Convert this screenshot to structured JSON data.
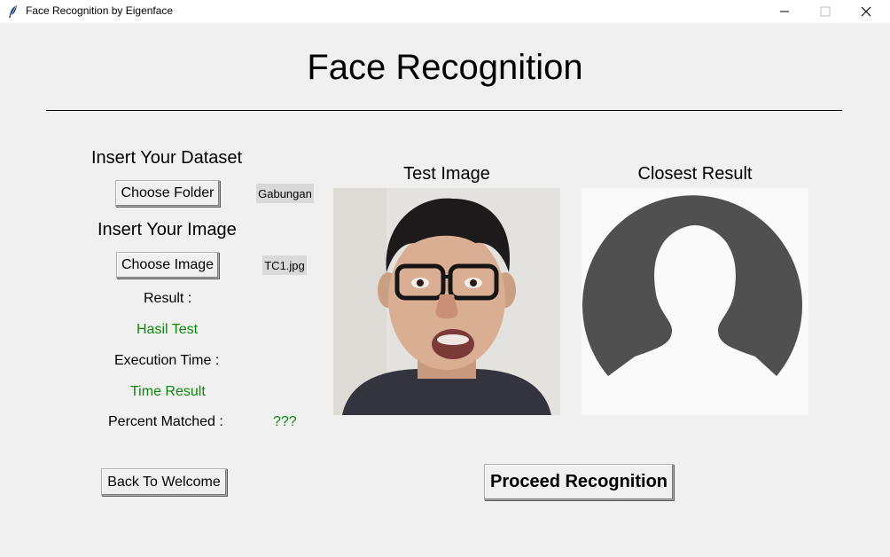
{
  "window": {
    "title": "Face Recognition by Eigenface"
  },
  "page": {
    "heading": "Face Recognition"
  },
  "dataset": {
    "label": "Insert Your Dataset",
    "button_label": "Choose Folder",
    "selected": "Gabungan"
  },
  "image": {
    "label": "Insert Your Image",
    "button_label": "Choose Image",
    "selected": "TC1.jpg"
  },
  "result": {
    "label": "Result :",
    "value": "Hasil Test"
  },
  "execution": {
    "label": "Execution Time :",
    "value": "Time Result"
  },
  "percent": {
    "label": "Percent Matched :",
    "value": "???"
  },
  "test_image": {
    "title": "Test Image"
  },
  "closest": {
    "title": "Closest Result"
  },
  "actions": {
    "back_label": "Back To Welcome",
    "proceed_label": "Proceed Recognition"
  },
  "colors": {
    "result_text": "#0a8a0a",
    "background": "#f0f0f0",
    "placeholder_bg": "#fafafa",
    "placeholder_fg": "#505050"
  }
}
